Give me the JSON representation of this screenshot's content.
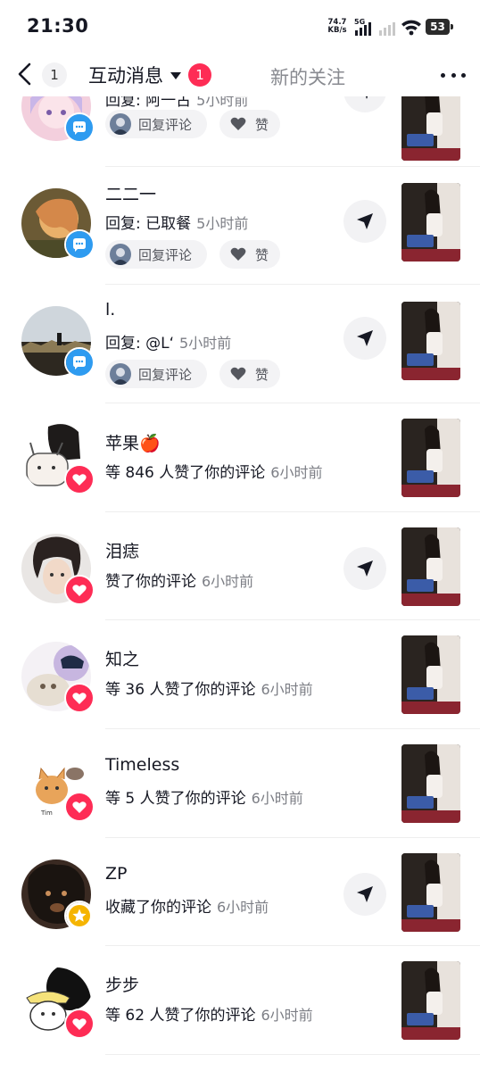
{
  "status_bar": {
    "time": "21:30",
    "net_speed_value": "74.7",
    "net_speed_unit": "KB/s",
    "network_type": "5G",
    "battery": "53"
  },
  "header": {
    "back_count": "1",
    "title": "互动消息",
    "title_badge": "1",
    "tab_follow": "新的关注",
    "icons": [
      "back-arrow-icon",
      "caret-down-icon",
      "more-icon"
    ]
  },
  "actions": {
    "reply_comment": "回复评论",
    "like": "赞"
  },
  "colors": {
    "accent_red": "#fe2c55",
    "comment_badge_blue": "#2e9bf0",
    "favorite_badge_gold": "#f5b400",
    "secondary_text": "#7c7e85"
  },
  "notifications": [
    {
      "name": "",
      "message": "回复: 阿一古",
      "time": "5小时前",
      "type": "reply"
    },
    {
      "name": "二二一",
      "message": "回复: 已取餐",
      "time": "5小时前",
      "type": "reply"
    },
    {
      "name": "l.",
      "message": "回复: @L‘",
      "time": "5小时前",
      "type": "reply"
    },
    {
      "name": "苹果🍎",
      "message": "等 846 人赞了你的评论",
      "time": "6小时前",
      "type": "like"
    },
    {
      "name": "泪痣",
      "message": "赞了你的评论",
      "time": "6小时前",
      "type": "like"
    },
    {
      "name": "知之",
      "message": "等 36 人赞了你的评论",
      "time": "6小时前",
      "type": "like"
    },
    {
      "name": "Timeless",
      "message": "等 5 人赞了你的评论",
      "time": "6小时前",
      "type": "like"
    },
    {
      "name": "ZP",
      "message": "收藏了你的评论",
      "time": "6小时前",
      "type": "favorite"
    },
    {
      "name": "步步",
      "message": "等 62 人赞了你的评论",
      "time": "6小时前",
      "type": "like"
    }
  ]
}
